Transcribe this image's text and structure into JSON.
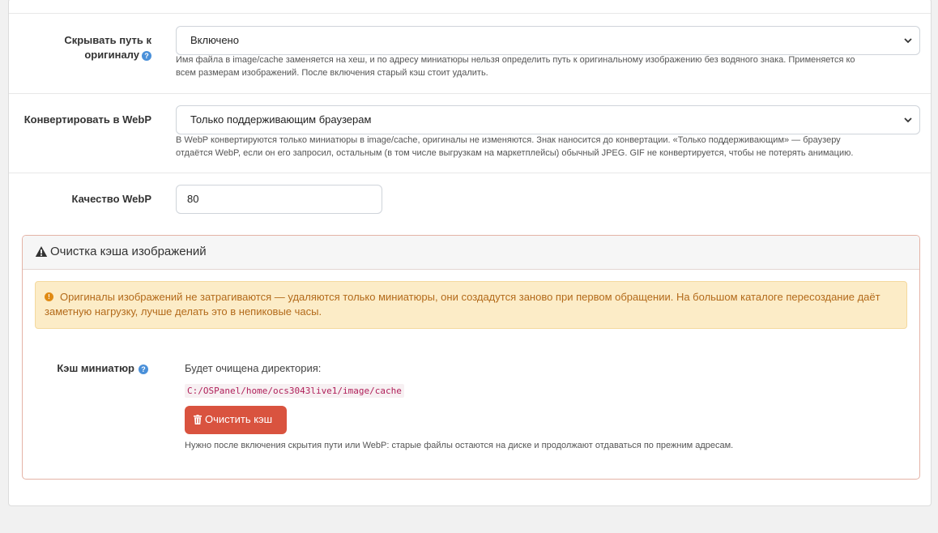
{
  "settings": {
    "hide_path": {
      "label_line1": "Скрывать путь к",
      "label_line2": "оригиналу",
      "help_icon": "question-circle-icon",
      "value": "Включено",
      "help_line1": "Имя файла в image/cache заменяется на хеш, и по адресу миниатюры нельзя определить путь к оригинальному изображению без водяного знака. Применяется ко",
      "help_line2": "всем размерам изображений. После включения старый кэш стоит удалить."
    },
    "webp": {
      "label": "Конвертировать в WebP",
      "value": "Только поддерживающим браузерам",
      "help_line1": "В WebP конвертируются только миниатюры в image/cache, оригиналы не изменяются. Знак наносится до конвертации. «Только поддерживающим» — браузеру",
      "help_line2": "отдаётся WebP, если он его запросил, остальным (в том числе выгрузкам на маркетплейсы) обычный JPEG. GIF не конвертируется, чтобы не потерять анимацию."
    },
    "quality": {
      "label": "Качество WebP",
      "value": "80"
    }
  },
  "cache_panel": {
    "title": "Очистка кэша изображений",
    "title_icon": "warning-triangle-icon",
    "alert_icon": "exclamation-circle-icon",
    "alert_text": "Оригиналы изображений не затрагиваются — удаляются только миниатюры, они создадутся заново при первом обращении. На большом каталоге пересоздание даёт заметную нагрузку, лучше делать это в непиковые часы.",
    "thumb_label": "Кэш миниатюр",
    "dir_label": "Будет очищена директория:",
    "dir_path": "C:/OSPanel/home/ocs3043live1/image/cache",
    "button_label": "Очистить кэш",
    "button_icon": "trash-icon",
    "note": "Нужно после включения скрытия пути или WebP: старые файлы остаются на диске и продолжают отдаваться по прежним адресам."
  },
  "colors": {
    "danger": "#d9533f",
    "alert_bg": "#fcecc7",
    "alert_text": "#b36a1a",
    "help_icon": "#4a90d9"
  }
}
